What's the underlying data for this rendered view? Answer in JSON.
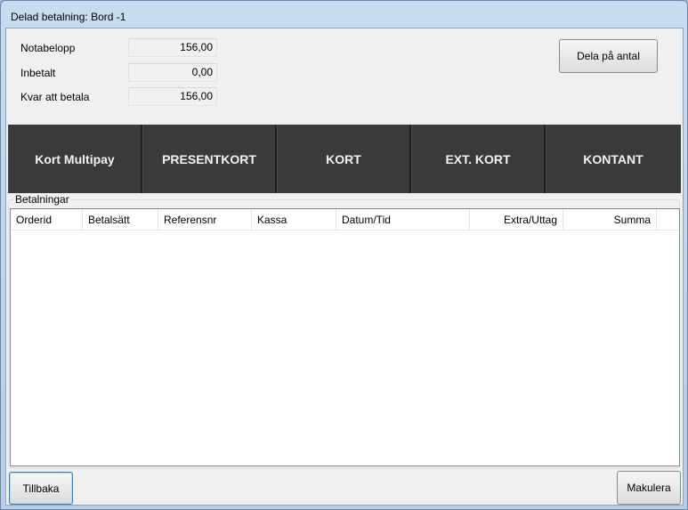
{
  "window": {
    "title": "Delad betalning: Bord -1"
  },
  "summary": {
    "rows": [
      {
        "label": "Notabelopp",
        "value": "156,00"
      },
      {
        "label": "Inbetalt",
        "value": "0,00"
      },
      {
        "label": "Kvar att betala",
        "value": "156,00"
      }
    ],
    "split_button_label": "Dela på antal"
  },
  "payment_methods": [
    {
      "label": "Kort Multipay"
    },
    {
      "label": "PRESENTKORT"
    },
    {
      "label": "KORT"
    },
    {
      "label": "EXT. KORT"
    },
    {
      "label": "KONTANT"
    }
  ],
  "payments": {
    "group_label": "Betalningar",
    "columns": [
      "Orderid",
      "Betalsätt",
      "Referensnr",
      "Kassa",
      "Datum/Tid",
      "Extra/Uttag",
      "Summa"
    ],
    "rows": []
  },
  "footer": {
    "back_label": "Tillbaka",
    "void_label": "Makulera"
  }
}
